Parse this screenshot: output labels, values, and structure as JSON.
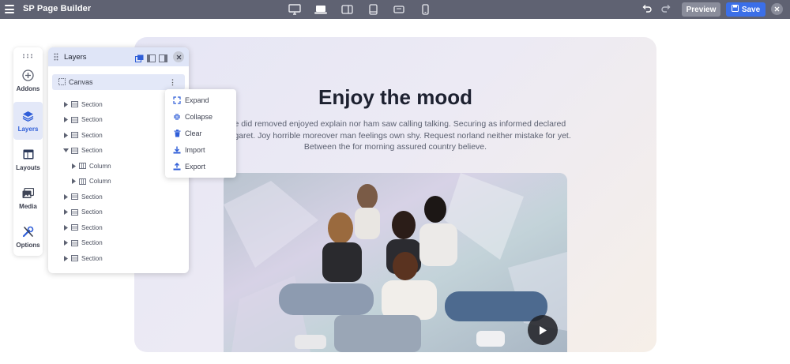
{
  "topbar": {
    "title": "SP Page Builder",
    "menu_icon": "hamburger-menu-icon",
    "devices": [
      {
        "name": "desktop-large",
        "icon": "monitor-icon",
        "active": false
      },
      {
        "name": "desktop",
        "icon": "laptop-icon",
        "active": true
      },
      {
        "name": "tablet-landscape",
        "icon": "tablet-landscape-icon",
        "active": false
      },
      {
        "name": "tablet",
        "icon": "tablet-portrait-icon",
        "active": false
      },
      {
        "name": "mobile-landscape",
        "icon": "mobile-landscape-icon",
        "active": false
      },
      {
        "name": "mobile",
        "icon": "mobile-portrait-icon",
        "active": false
      }
    ],
    "preview_label": "Preview",
    "save_label": "Save",
    "colors": {
      "bar": "#5f6272",
      "save": "#3b6fe8",
      "preview": "#8a8d9b"
    }
  },
  "sidepanel": {
    "items": [
      {
        "label": "Addons",
        "icon": "plus-circle-icon",
        "active": false
      },
      {
        "label": "Layers",
        "icon": "layers-icon",
        "active": true
      },
      {
        "label": "Layouts",
        "icon": "layout-icon",
        "active": false
      },
      {
        "label": "Media",
        "icon": "media-icon",
        "active": false
      },
      {
        "label": "Options",
        "icon": "tools-icon",
        "active": false
      }
    ]
  },
  "layers": {
    "title": "Layers",
    "root_label": "Canvas",
    "rows": [
      {
        "label": "Section",
        "depth": 0,
        "expanded": false
      },
      {
        "label": "Section",
        "depth": 0,
        "expanded": false
      },
      {
        "label": "Section",
        "depth": 0,
        "expanded": false
      },
      {
        "label": "Section",
        "depth": 0,
        "expanded": true
      },
      {
        "label": "Column",
        "depth": 1,
        "expanded": false
      },
      {
        "label": "Column",
        "depth": 1,
        "expanded": false
      },
      {
        "label": "Section",
        "depth": 0,
        "expanded": false
      },
      {
        "label": "Section",
        "depth": 0,
        "expanded": false
      },
      {
        "label": "Section",
        "depth": 0,
        "expanded": false
      },
      {
        "label": "Section",
        "depth": 0,
        "expanded": false
      },
      {
        "label": "Section",
        "depth": 0,
        "expanded": false
      }
    ]
  },
  "context_menu": {
    "items": [
      {
        "label": "Expand",
        "icon": "expand-icon"
      },
      {
        "label": "Collapse",
        "icon": "collapse-icon"
      },
      {
        "label": "Clear",
        "icon": "trash-icon"
      },
      {
        "label": "Import",
        "icon": "import-icon"
      },
      {
        "label": "Export",
        "icon": "export-icon"
      }
    ]
  },
  "hero": {
    "title": "Enjoy the mood",
    "text": "age did removed enjoyed explain nor ham saw calling talking. Securing as informed declared margaret. Joy horrible moreover man feelings own shy. Request norland neither mistake for yet. Between the for morning assured country believe.",
    "image_alt": "group-photo",
    "video_icon": "play-icon"
  }
}
